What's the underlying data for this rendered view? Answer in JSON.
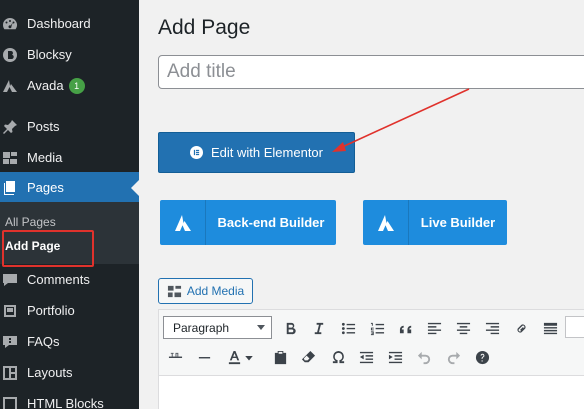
{
  "sidebar": {
    "items": [
      {
        "label": "Dashboard",
        "icon": "dashboard-icon"
      },
      {
        "label": "Blocksy",
        "icon": "blocksy-icon"
      },
      {
        "label": "Avada",
        "icon": "avada-icon",
        "badge": "1"
      },
      {
        "label": "Posts",
        "icon": "pushpin-icon"
      },
      {
        "label": "Media",
        "icon": "media-icon"
      },
      {
        "label": "Pages",
        "icon": "pages-icon",
        "active": true
      },
      {
        "label": "Comments",
        "icon": "comments-icon"
      },
      {
        "label": "Portfolio",
        "icon": "portfolio-icon"
      },
      {
        "label": "FAQs",
        "icon": "faqs-icon"
      },
      {
        "label": "Layouts",
        "icon": "layouts-icon"
      },
      {
        "label": "HTML Blocks",
        "icon": "html-blocks-icon"
      }
    ],
    "submenu": [
      {
        "label": "All Pages"
      },
      {
        "label": "Add Page",
        "current": true
      }
    ]
  },
  "main": {
    "title": "Add Page",
    "title_placeholder": "Add title",
    "elementor_button": "Edit with Elementor",
    "backend_builder": "Back-end Builder",
    "live_builder": "Live Builder",
    "add_media": "Add Media"
  },
  "editor": {
    "format_value": "Paragraph"
  },
  "colors": {
    "sidebar_bg": "#1d2327",
    "accent": "#2271b1",
    "avada_blue": "#1e8cdd",
    "annotation_red": "#e0322c"
  }
}
